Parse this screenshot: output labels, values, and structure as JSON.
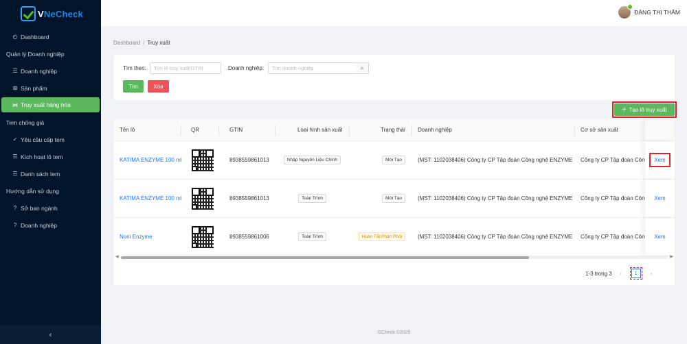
{
  "brand": {
    "name_v": "V",
    "name_rest": "NeCheck"
  },
  "sidebar": {
    "items": [
      {
        "label": "Dashboard",
        "icon": "◴",
        "type": "item"
      },
      {
        "label": "Quản lý Doanh nghiệp",
        "type": "group"
      },
      {
        "label": "Doanh nghiệp",
        "icon": "☰",
        "type": "item"
      },
      {
        "label": "Sản phẩm",
        "icon": "⊞",
        "type": "item"
      },
      {
        "label": "Truy xuất hàng hóa",
        "icon": "⋈",
        "type": "item",
        "active": true
      },
      {
        "label": "Tem chống giả",
        "type": "group"
      },
      {
        "label": "Yêu cầu cấp tem",
        "icon": "✓",
        "type": "item"
      },
      {
        "label": "Kích hoạt lô tem",
        "icon": "☰",
        "type": "item"
      },
      {
        "label": "Danh sách tem",
        "icon": "☰",
        "type": "item"
      },
      {
        "label": "Hướng dẫn sử dụng",
        "type": "group"
      },
      {
        "label": "Sở ban ngành",
        "icon": "?",
        "type": "item"
      },
      {
        "label": "Doanh nghiệp",
        "icon": "?",
        "type": "item"
      }
    ],
    "collapse_icon": "‹"
  },
  "header": {
    "user_name": "ĐẶNG THỊ THẮM"
  },
  "breadcrumb": {
    "root": "Dashboard",
    "sep": "/",
    "current": "Truy xuất"
  },
  "filter": {
    "search_label": "Tìm theo:",
    "search_placeholder": "Tìm lô truy xuất/GTIN",
    "company_label": "Doanh nghiệp:",
    "company_placeholder": "Tìm doanh nghiệp",
    "find_button": "Tìm",
    "clear_button": "Xóa"
  },
  "create_button": {
    "plus": "+",
    "label": "Tạo lô truy xuất"
  },
  "table": {
    "headers": {
      "name": "Tên lô",
      "qr": "QR",
      "gtin": "GTIN",
      "type": "Loại hình sản xuất",
      "status": "Trạng thái",
      "company": "Doanh nghiệp",
      "facility": "Cơ sở sản xuất"
    },
    "rows": [
      {
        "name": "KATIMA ENZYME 100 ml",
        "gtin": "8938559861013",
        "type": "Nhập Nguyên Liệu Chính",
        "status": "Mới Tạo",
        "company": "(MST: 1102038406) Công ty CP Tập đoàn Công nghệ ENZYME",
        "facility": "Công ty CP Tập đoàn Công",
        "action": "Xem"
      },
      {
        "name": "KATIMA ENZYME 100 ml",
        "gtin": "8938559861013",
        "type": "Toàn Trình",
        "status": "Mới Tạo",
        "company": "(MST: 1102038406) Công ty CP Tập đoàn Công nghệ ENZYME",
        "facility": "Công ty CP Tập đoàn Công",
        "action": "Xem"
      },
      {
        "name": "Noni Enzyme",
        "gtin": "8938559861006",
        "type": "Toàn Trình",
        "status": "Hoàn Tất Phân Phối",
        "company": "(MST: 1102038406) Công ty CP Tập đoàn Công nghệ ENZYME",
        "facility": "Công ty CP Tập đoàn Công",
        "action": "Xem"
      }
    ]
  },
  "pagination": {
    "range": "1-3 trong 3",
    "page": "1",
    "prev": "‹",
    "next": "›"
  },
  "footer": {
    "text": "GCheck ©2025"
  }
}
